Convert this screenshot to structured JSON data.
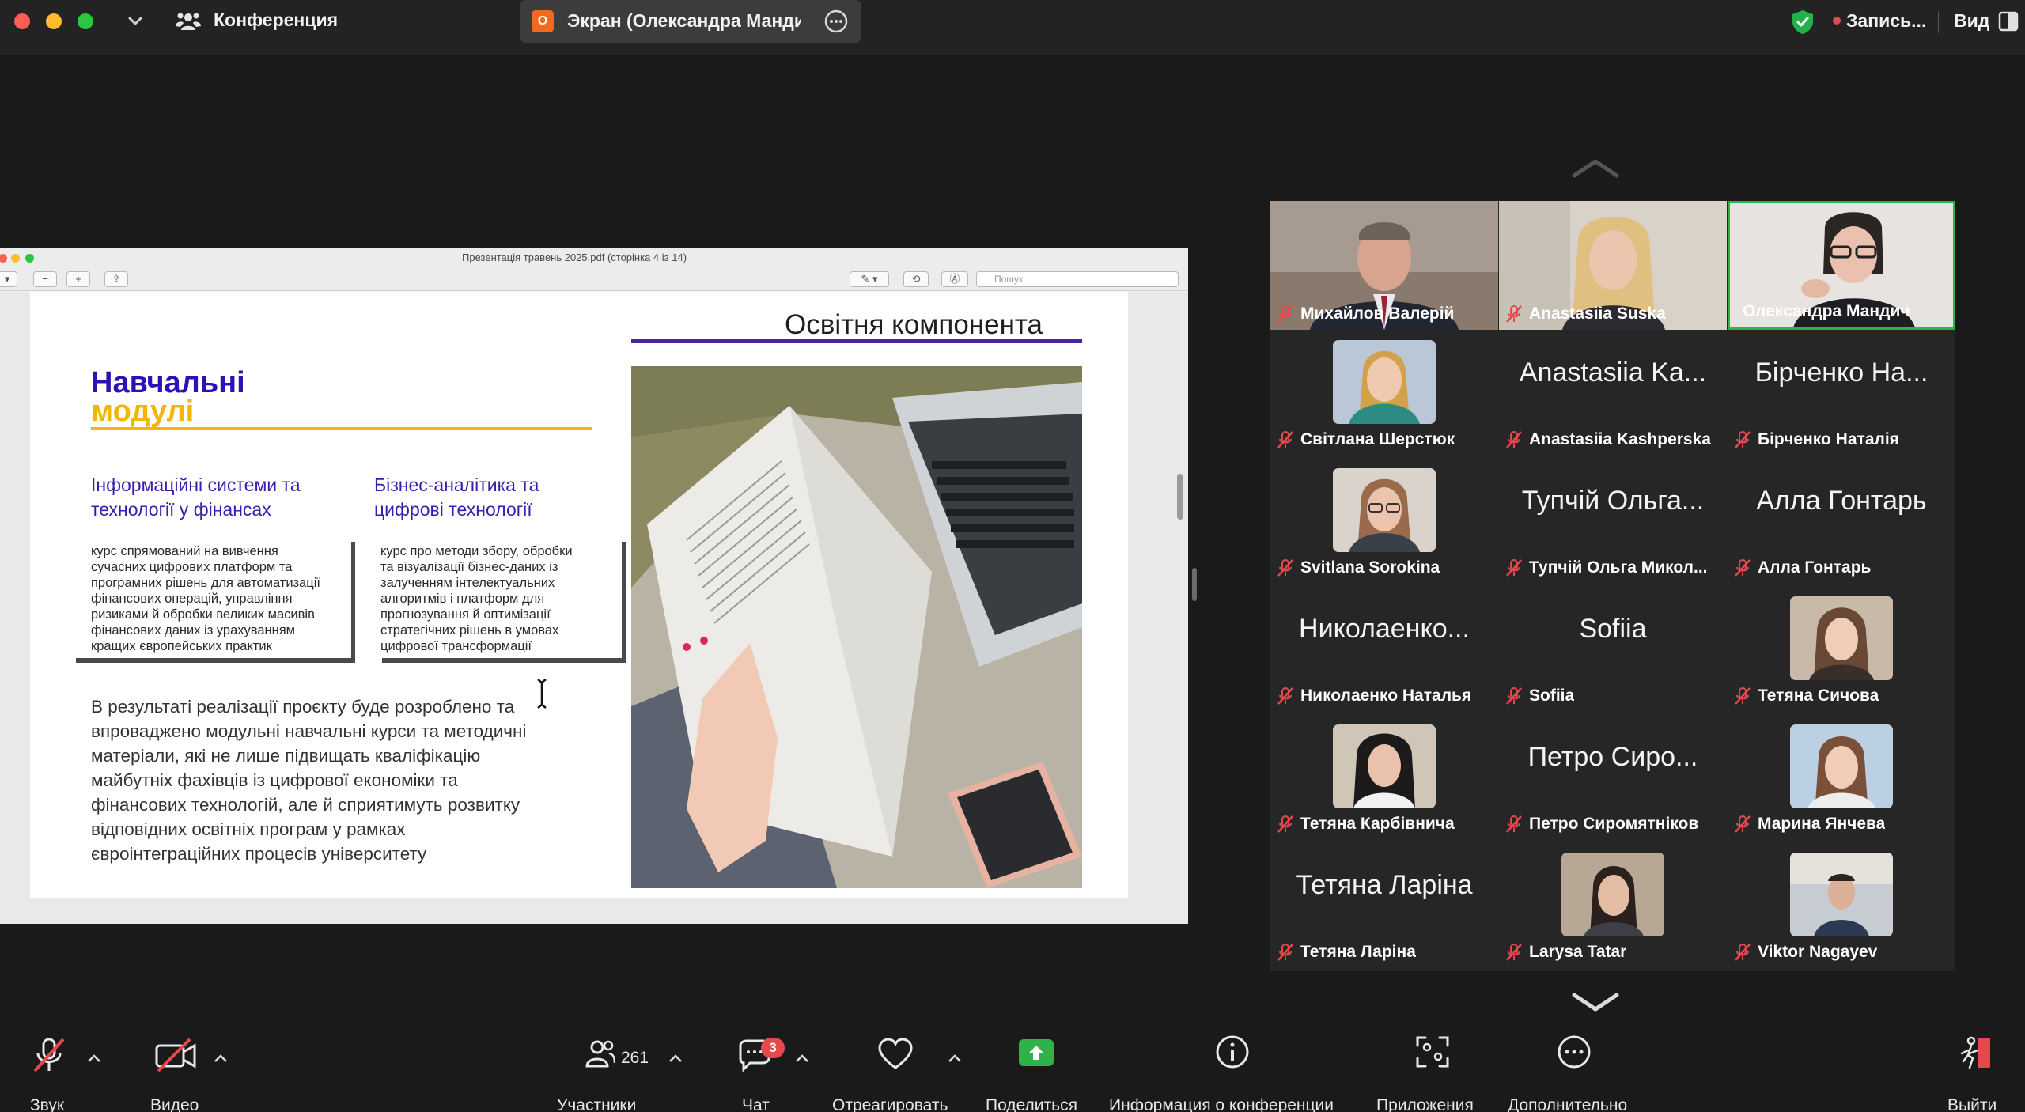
{
  "topbar": {
    "meeting_title": "Конференция",
    "screen_share_label": "Экран (Олександра Мандич",
    "screen_badge": "O",
    "recording_label": "Запись...",
    "view_label": "Вид"
  },
  "shared_screen": {
    "window_caption": "Презентація травень 2025.pdf (сторінка 4 із 14)",
    "search_placeholder": "Пошук",
    "slide": {
      "heading": "Освітня компонента",
      "modules_line1": "Навчальні",
      "modules_line2": "модулі",
      "course1_title_1": "Інформаційні системи та",
      "course1_title_2": "технології у фінансах",
      "course1_desc": [
        "курс спрямований на вивчення",
        "сучасних цифрових платформ та",
        "програмних рішень для автоматизації",
        "фінансових операцій, управління",
        "ризиками й обробки великих масивів",
        "фінансових даних із урахуванням",
        "кращих європейських практик"
      ],
      "course2_title_1": "Бізнес-аналітика та",
      "course2_title_2": "цифрові технології",
      "course2_desc": [
        "курс про методи збору, обробки",
        "та візуалізації бізнес-даних із",
        "залученням інтелектуальних",
        "алгоритмів і платформ для",
        "прогнозування й оптимізації",
        "стратегічних рішень в умовах",
        "цифрової трансформації"
      ],
      "body": [
        "В результаті реалізації проєкту буде розроблено та",
        "впроваджено модульні навчальні курси та методичні",
        "матеріали, які не лише підвищать кваліфікацію",
        "майбутніх фахівців із цифрової економіки та",
        "фінансових технологій, але й сприятимуть розвитку",
        "відповідних освітніх програм у рамках",
        "євроінтеграційних процесів університету"
      ]
    }
  },
  "gallery": {
    "video_tiles": [
      {
        "name": "Михайлов Валерій"
      },
      {
        "name": "Anastasiia Suska"
      },
      {
        "name": "Олександра Мандич",
        "active": true
      }
    ],
    "participants": [
      {
        "big": "",
        "name": "Світлана Шерстюк",
        "avatar": true
      },
      {
        "big": "Anastasiia Ka...",
        "name": "Anastasiia Kashperska",
        "avatar": false
      },
      {
        "big": "Бірченко На...",
        "name": "Бірченко Наталія",
        "avatar": false
      },
      {
        "big": "",
        "name": "Svitlana Sorokina",
        "avatar": true
      },
      {
        "big": "Тупчій Ольга...",
        "name": "Тупчій Ольга Микол...",
        "avatar": false
      },
      {
        "big": "Алла Гонтарь",
        "name": "Алла Гонтарь",
        "avatar": false
      },
      {
        "big": "Николаенко...",
        "name": "Николаенко Наталья",
        "avatar": false
      },
      {
        "big": "Sofiia",
        "name": "Sofiia",
        "avatar": false
      },
      {
        "big": "",
        "name": "Тетяна Сичова",
        "avatar": true
      },
      {
        "big": "",
        "name": "Тетяна Карбівнича",
        "avatar": true
      },
      {
        "big": "Петро Сиро...",
        "name": "Петро Сиромятніков",
        "avatar": false
      },
      {
        "big": "",
        "name": "Марина Янчева",
        "avatar": true
      },
      {
        "big": "Тетяна Ларіна",
        "name": "Тетяна Ларіна",
        "avatar": false
      },
      {
        "big": "",
        "name": "Larysa Tatar",
        "avatar": true
      },
      {
        "big": "",
        "name": "Viktor Nagayev",
        "avatar": true
      }
    ]
  },
  "toolbar": {
    "audio_label": "Звук",
    "video_label": "Видео",
    "participants_label": "Участники",
    "participants_count": "261",
    "chat_label": "Чат",
    "chat_badge": "3",
    "react_label": "Отреагировать",
    "share_label": "Поделиться",
    "info_label": "Информация о конференции",
    "apps_label": "Приложения",
    "more_label": "Дополнительно",
    "leave_label": "Выйти"
  },
  "colors": {
    "accent_green": "#2fb24a",
    "leave_red": "#e5484d",
    "slide_purple": "#2b12b8",
    "slide_yellow": "#f2b705"
  }
}
